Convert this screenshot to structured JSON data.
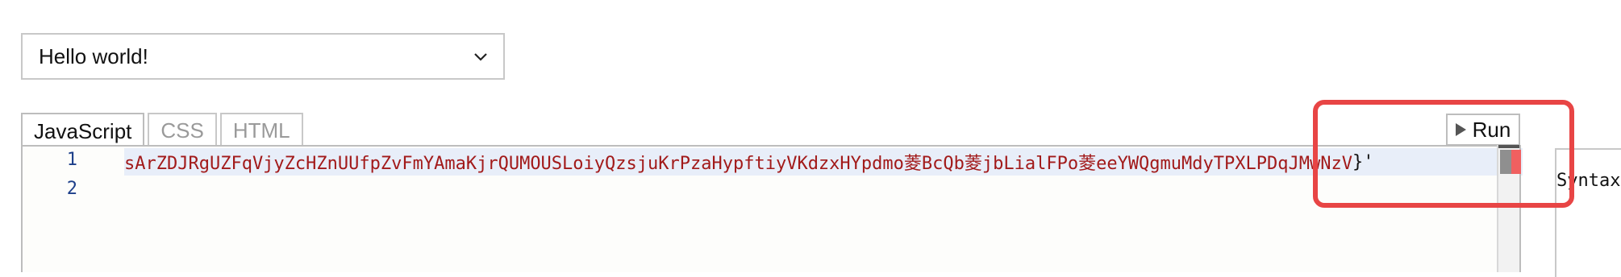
{
  "example_select": {
    "selected": "Hello world!",
    "icon": "chevron-down-icon"
  },
  "tabs": [
    {
      "label": "JavaScript",
      "active": true
    },
    {
      "label": "CSS",
      "active": false
    },
    {
      "label": "HTML",
      "active": false
    }
  ],
  "run_button": {
    "label": "Run",
    "icon": "play-icon"
  },
  "editor": {
    "lines": [
      {
        "number": "1",
        "code": "sArZDJRgUZFqVjyZcHZnUUfpZvFmYAmaKjrQUMOUSLoiyQzsjuKrPzaHypftiyVKdzxHYpdmo菱BcQb菱jbLialFPo菱eeYWQgmuMdyTPXLPDqJMwNzV",
        "tail": "}'"
      },
      {
        "number": "2",
        "code": "",
        "tail": ""
      }
    ]
  },
  "output": {
    "text": "Syntax"
  },
  "colors": {
    "code_string": "#a21a1a",
    "line_number": "#1d3f8a",
    "annotation": "#e84545"
  }
}
